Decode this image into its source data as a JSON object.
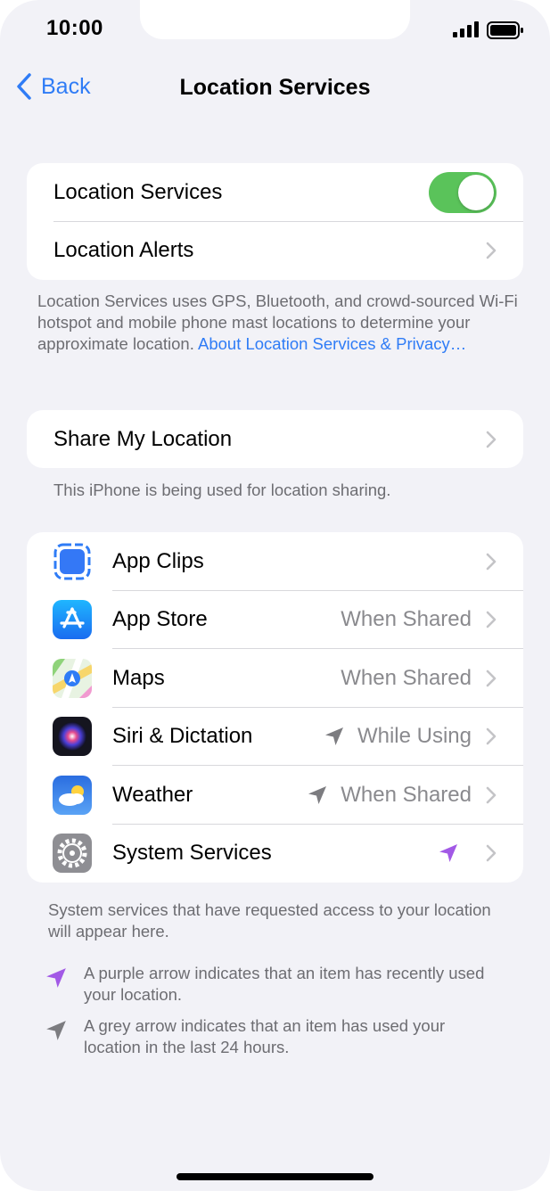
{
  "status": {
    "time": "10:00"
  },
  "nav": {
    "back_label": "Back",
    "title": "Location Services"
  },
  "group1": {
    "location_services_label": "Location Services",
    "location_services_on": true,
    "location_alerts_label": "Location Alerts"
  },
  "info": {
    "text": "Location Services uses GPS, Bluetooth, and crowd-sourced Wi-Fi hotspot and mobile phone mast locations to determine your approximate location.",
    "link": "About Location Services & Privacy…"
  },
  "share": {
    "label": "Share My Location",
    "note": "This iPhone is being used for location sharing."
  },
  "apps": [
    {
      "name": "App Clips",
      "value": "",
      "arrow": "",
      "icon": "app-clips-icon"
    },
    {
      "name": "App Store",
      "value": "When Shared",
      "arrow": "",
      "icon": "app-store-icon"
    },
    {
      "name": "Maps",
      "value": "When Shared",
      "arrow": "",
      "icon": "maps-icon"
    },
    {
      "name": "Siri & Dictation",
      "value": "While Using",
      "arrow": "grey",
      "icon": "siri-icon"
    },
    {
      "name": "Weather",
      "value": "When Shared",
      "arrow": "grey",
      "icon": "weather-icon"
    },
    {
      "name": "System Services",
      "value": "",
      "arrow": "purple",
      "icon": "system-services-gear-icon"
    }
  ],
  "system_note": "System services that have requested access to your location will appear here.",
  "legend": {
    "purple": "A purple arrow indicates that an item has recently used your location.",
    "grey": "A grey arrow indicates that an item has used your location in the last 24 hours."
  },
  "colors": {
    "accent": "#2f7cf6",
    "toggle_on": "#5ac35a",
    "purple_arrow": "#a259e6",
    "grey_arrow": "#7c7c80"
  }
}
